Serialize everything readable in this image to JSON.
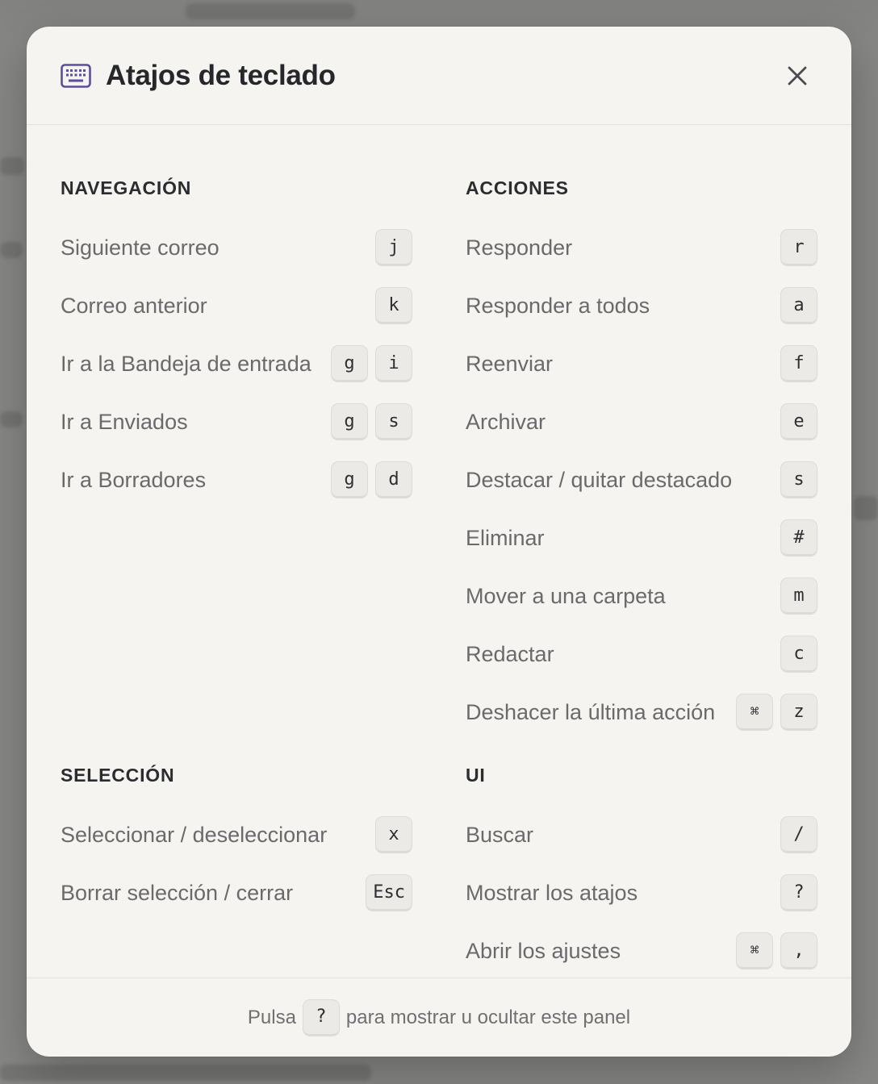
{
  "dialog": {
    "title": "Atajos de teclado",
    "icon": "keyboard-icon",
    "close_icon": "close-icon",
    "accent_color": "#5b4e9a"
  },
  "sections": {
    "navegacion": {
      "title": "NAVEGACIÓN",
      "items": [
        {
          "label": "Siguiente correo",
          "keys": [
            "j"
          ]
        },
        {
          "label": "Correo anterior",
          "keys": [
            "k"
          ]
        },
        {
          "label": "Ir a la Bandeja de entrada",
          "keys": [
            "g",
            "i"
          ]
        },
        {
          "label": "Ir a Enviados",
          "keys": [
            "g",
            "s"
          ]
        },
        {
          "label": "Ir a Borradores",
          "keys": [
            "g",
            "d"
          ]
        }
      ]
    },
    "acciones": {
      "title": "ACCIONES",
      "items": [
        {
          "label": "Responder",
          "keys": [
            "r"
          ]
        },
        {
          "label": "Responder a todos",
          "keys": [
            "a"
          ]
        },
        {
          "label": "Reenviar",
          "keys": [
            "f"
          ]
        },
        {
          "label": "Archivar",
          "keys": [
            "e"
          ]
        },
        {
          "label": "Destacar / quitar destacado",
          "keys": [
            "s"
          ]
        },
        {
          "label": "Eliminar",
          "keys": [
            "#"
          ]
        },
        {
          "label": "Mover a una carpeta",
          "keys": [
            "m"
          ]
        },
        {
          "label": "Redactar",
          "keys": [
            "c"
          ]
        },
        {
          "label": "Deshacer la última acción",
          "keys": [
            "⌘",
            "z"
          ]
        }
      ]
    },
    "seleccion": {
      "title": "SELECCIÓN",
      "items": [
        {
          "label": "Seleccionar / deseleccionar",
          "keys": [
            "x"
          ]
        },
        {
          "label": "Borrar selección / cerrar",
          "keys": [
            "Esc"
          ]
        }
      ]
    },
    "ui": {
      "title": "UI",
      "items": [
        {
          "label": "Buscar",
          "keys": [
            "/"
          ]
        },
        {
          "label": "Mostrar los atajos",
          "keys": [
            "?"
          ]
        },
        {
          "label": "Abrir los ajustes",
          "keys": [
            "⌘",
            ","
          ]
        }
      ]
    }
  },
  "footer": {
    "prefix": "Pulsa",
    "key": "?",
    "suffix": "para mostrar u ocultar este panel"
  }
}
